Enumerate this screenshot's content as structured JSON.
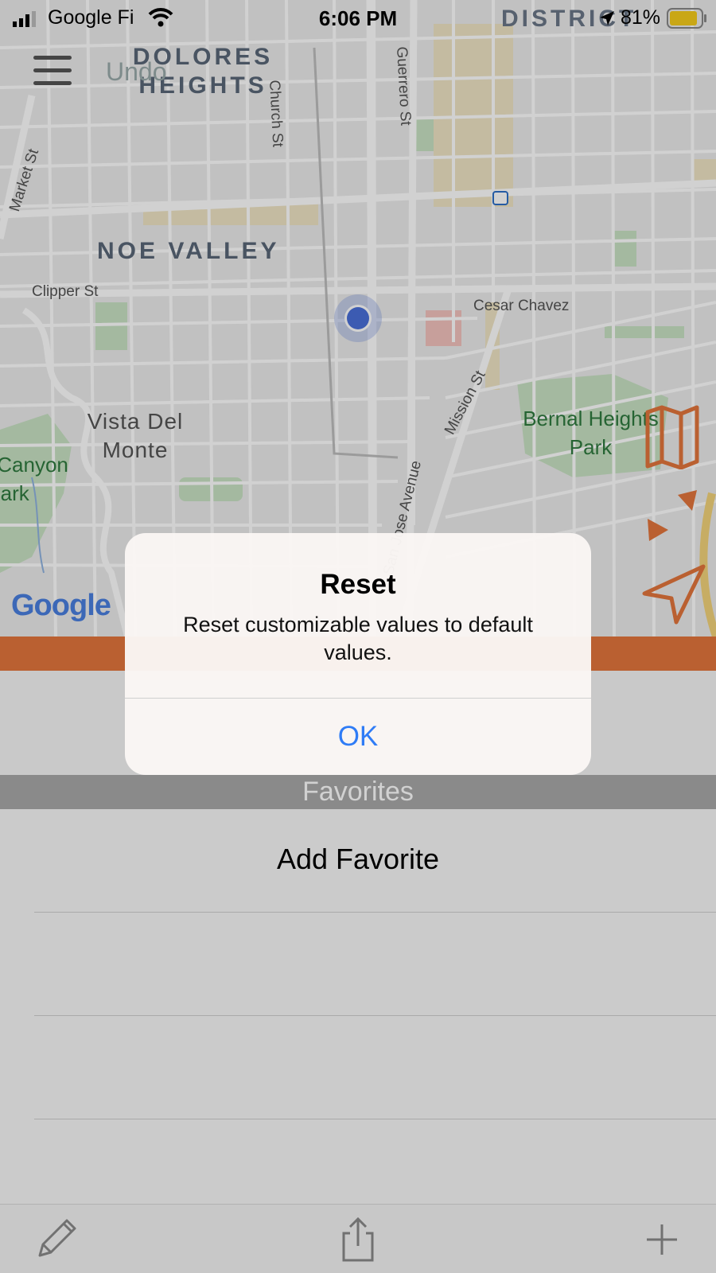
{
  "status_bar": {
    "carrier": "Google Fi",
    "time": "6:06 PM",
    "battery": "81%"
  },
  "map": {
    "undo_label": "Undo",
    "neighborhoods_bold": [
      "DOLORES HEIGHTS",
      "NOE VALLEY",
      "DISTRICT"
    ],
    "neighborhoods_plain": [
      "Vista Del Monte"
    ],
    "streets": [
      "Church St",
      "Guerrero St",
      "Market St",
      "Clipper St",
      "Cesar Chavez",
      "Mission St",
      "San Jose Avenue"
    ],
    "parks": [
      "Bernal Heights Park",
      "Glen Canyon Park"
    ],
    "logo": "Google"
  },
  "alert": {
    "title": "Reset",
    "message": "Reset customizable values to default values.",
    "ok_label": "OK"
  },
  "favorites": {
    "header": "Favorites",
    "add_label": "Add Favorite"
  },
  "colors": {
    "accent": "#e3763c",
    "link": "#2f7cf6",
    "location_dot": "#4a6fd9"
  },
  "icons": {
    "toolbar": [
      "pencil-icon",
      "share-icon",
      "plus-icon"
    ],
    "map_controls": [
      "map-icon",
      "layers-icon",
      "navigation-arrow-icon"
    ]
  }
}
